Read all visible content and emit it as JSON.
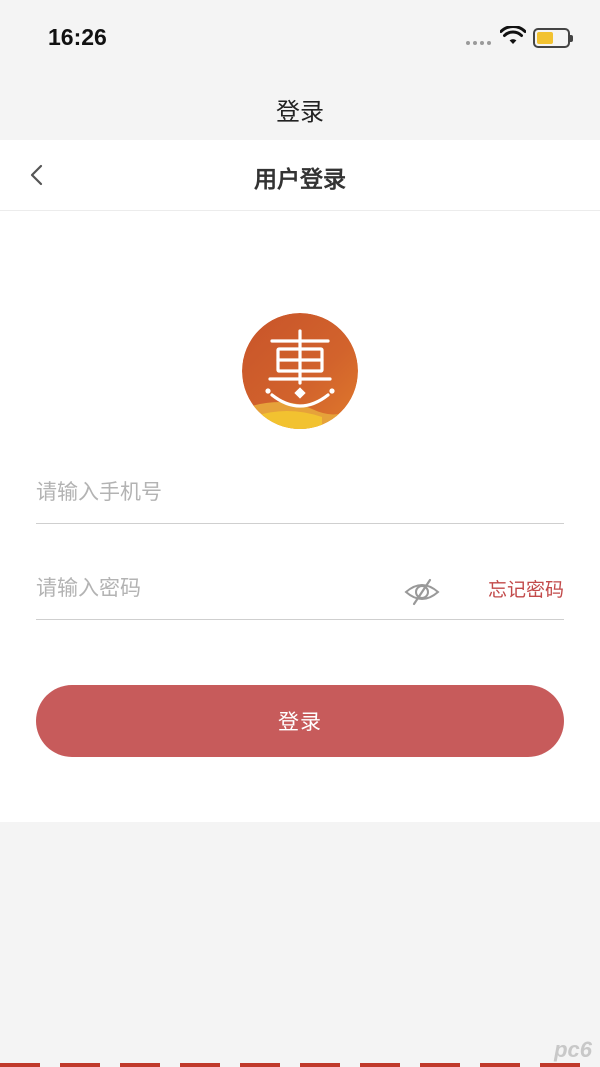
{
  "status_bar": {
    "time": "16:26",
    "icons": [
      "signal-dots",
      "wifi-icon",
      "battery-icon"
    ]
  },
  "app_bar": {
    "title": "登录"
  },
  "nav": {
    "back_icon": "chevron-left-icon",
    "title": "用户登录"
  },
  "logo": {
    "glyph": "惠",
    "colors": {
      "red": "#c8542a",
      "orange": "#e07a2c",
      "yellow": "#f2c230"
    }
  },
  "form": {
    "phone_placeholder": "请输入手机号",
    "phone_value": "",
    "password_placeholder": "请输入密码",
    "password_value": "",
    "eye_icon": "eye-off-icon",
    "forgot_label": "忘记密码"
  },
  "login_button": {
    "label": "登录"
  },
  "watermark": {
    "text": "pc6"
  },
  "colors": {
    "accent": "#c75b5b",
    "link": "#c24a4a",
    "background": "#f4f4f4",
    "panel": "#ffffff"
  }
}
